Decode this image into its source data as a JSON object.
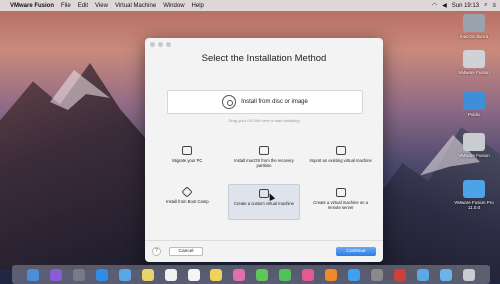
{
  "menubar": {
    "apple": "",
    "app_name": "VMware Fusion",
    "items": [
      "File",
      "Edit",
      "View",
      "Virtual Machine",
      "Window",
      "Help"
    ],
    "clock": "Sun 19:13"
  },
  "desktop_icons": [
    {
      "label": "macOS Sierra",
      "color": "#9aa3ad"
    },
    {
      "label": "VMware Fusion",
      "color": "#cfd3d8"
    },
    {
      "label": "Public",
      "color": "#3f8fd8"
    },
    {
      "label": "VMware Fusion",
      "color": "#c9cdd2"
    },
    {
      "label": "VMware Fusion Pro 11.0.0",
      "color": "#4da3e8"
    }
  ],
  "window": {
    "title": "Select the Installation Method",
    "disc_option": "Install from disc or image",
    "drag_hint": "Drag your ISO file here to start installing",
    "options": [
      {
        "label": "Migrate your PC",
        "icon": "pc-icon",
        "selected": false
      },
      {
        "label": "Install macOS from the recovery partition",
        "icon": "laptop-icon",
        "selected": false
      },
      {
        "label": "Import an existing virtual machine",
        "icon": "import-icon",
        "selected": false
      },
      {
        "label": "Install from Boot Camp",
        "icon": "bootcamp-icon",
        "selected": false
      },
      {
        "label": "Create a custom virtual machine",
        "icon": "custom-vm-icon",
        "selected": true
      },
      {
        "label": "Create a virtual machine on a remote server",
        "icon": "remote-server-icon",
        "selected": false
      }
    ],
    "help": "?",
    "cancel": "Cancel",
    "continue": "Continue"
  },
  "dock": {
    "items": [
      "finder-icon",
      "siri-icon",
      "launchpad-icon",
      "safari-icon",
      "mail-icon",
      "notes-icon",
      "calendar-icon",
      "reminders-icon",
      "stickies-icon",
      "photos-icon",
      "messages-icon",
      "facetime-icon",
      "itunes-icon",
      "ibooks-icon",
      "appstore-icon",
      "preferences-icon",
      "vmware-icon",
      "folder-icon",
      "downloads-icon",
      "trash-icon"
    ],
    "colors": [
      "#4a90d9",
      "#8a5cd6",
      "#7a7a86",
      "#2f8de4",
      "#5aa7e8",
      "#e9d36a",
      "#f2f2f2",
      "#f4f4f4",
      "#f0d25a",
      "#e06fb1",
      "#5fc65a",
      "#4fc25a",
      "#e55a8e",
      "#f08b2c",
      "#3ea0f0",
      "#8a8a8a",
      "#d0403a",
      "#5aa9e6",
      "#6ab4ea",
      "#c9ccd2"
    ]
  }
}
